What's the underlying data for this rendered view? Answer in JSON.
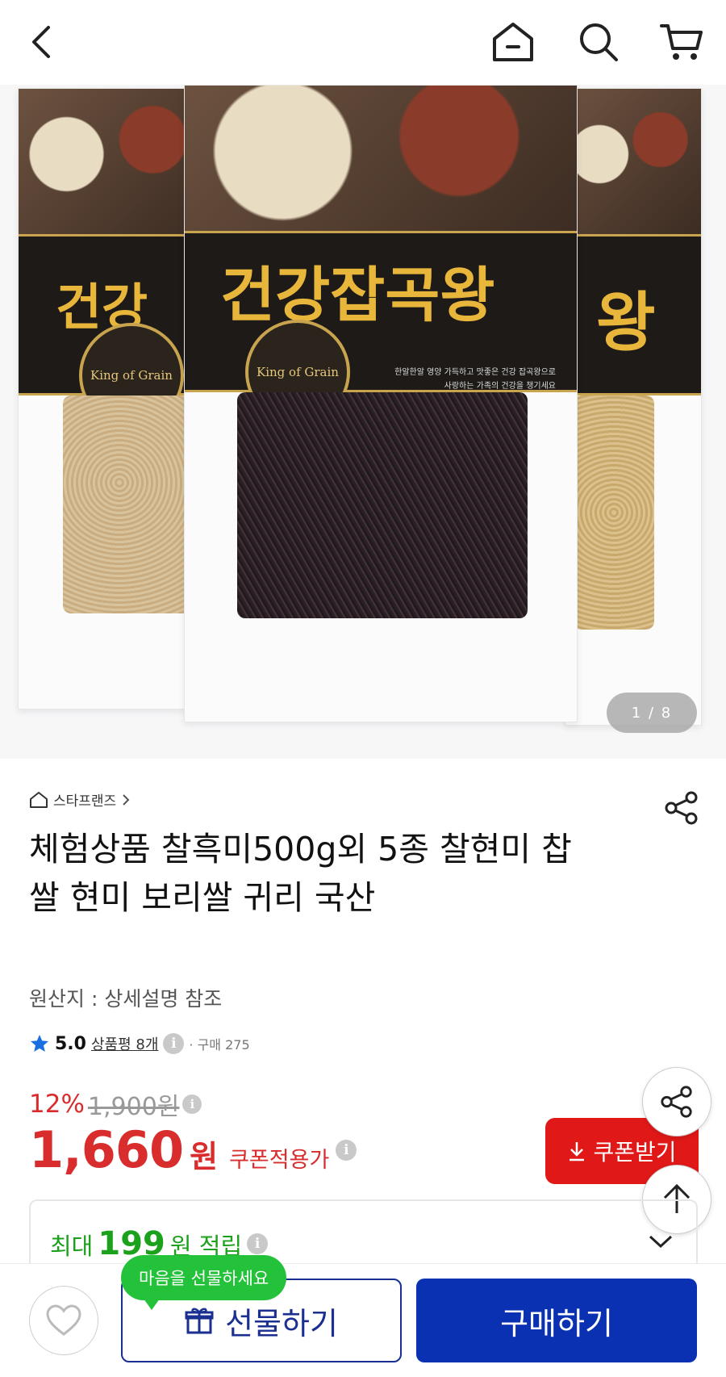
{
  "header": {
    "back_icon": "chevron-left-icon",
    "home_icon": "home-icon",
    "search_icon": "search-icon",
    "cart_icon": "cart-icon"
  },
  "gallery": {
    "package_brand": "건강잡곡왕",
    "package_brand_partial_left": "건강",
    "package_brand_partial_right": "왕",
    "package_seal": "King of Grain",
    "package_copy_line1": "한알한알 영양 가득하고 맛좋은 건강 잡곡왕으로",
    "package_copy_line2": "사랑하는 가족의 건강을 챙기세요",
    "pager": "1 / 8"
  },
  "product": {
    "store": "스타프랜즈",
    "title": "체험상품 찰흑미500g외 5종 찰현미 찹쌀 현미 보리쌀 귀리 국산",
    "origin": "원산지 : 상세설명 참조",
    "rating": "5.0",
    "reviews": "상품평 8개",
    "purchases": "· 구매 275",
    "discount": "12%",
    "original_price": "1,900원",
    "price": "1,660",
    "price_unit": "원",
    "coupon_note": "쿠폰적용가",
    "coupon_button": "쿠폰받기"
  },
  "points": {
    "prefix": "최대",
    "amount": "199",
    "suffix": "원 적립"
  },
  "bottom": {
    "tooltip": "마음을 선물하세요",
    "gift_button": "선물하기",
    "buy_button": "구매하기"
  },
  "colors": {
    "accent_red": "#e01818",
    "buy_blue": "#0b31b3",
    "points_green": "#1ba11b",
    "tooltip_green": "#23c23a"
  }
}
